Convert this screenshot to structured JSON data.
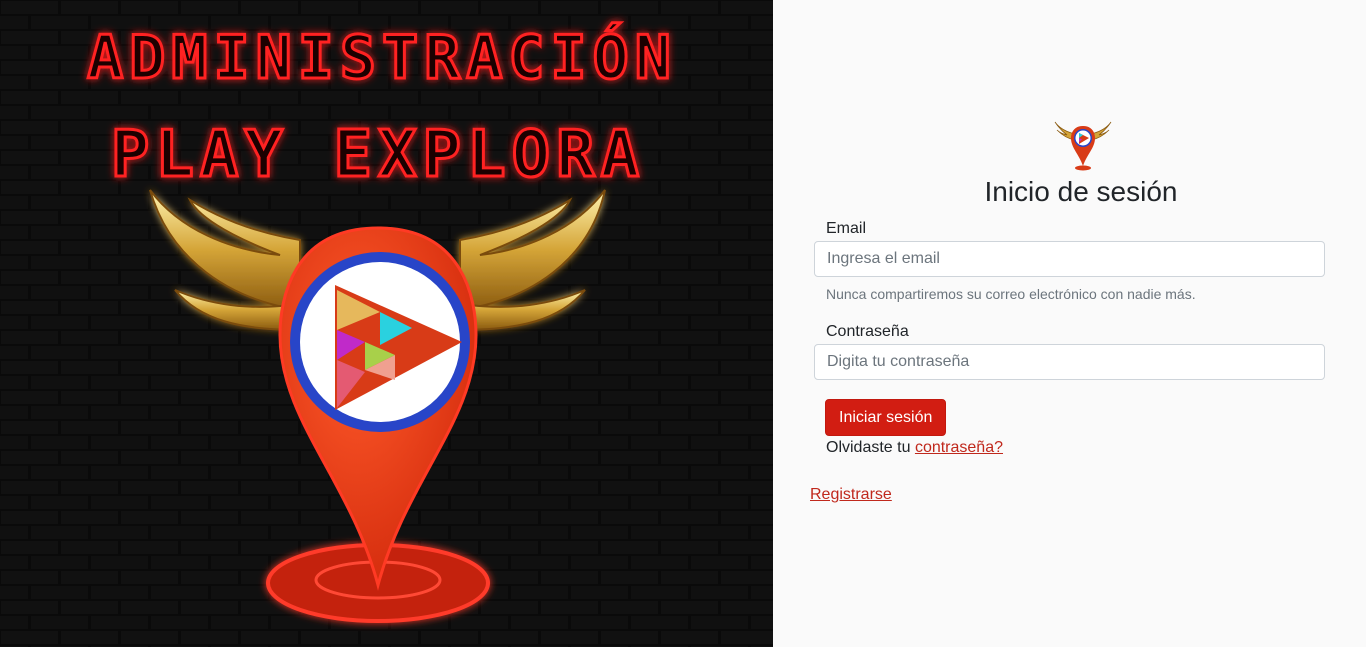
{
  "hero": {
    "line1": "ADMINISTRACIÓN",
    "line2": "PLAY EXPLORA"
  },
  "login": {
    "title": "Inicio de sesión",
    "email_label": "Email",
    "email_placeholder": "Ingresa el email",
    "email_help": "Nunca compartiremos su correo electrónico con nadie más.",
    "password_label": "Contraseña",
    "password_placeholder": "Digita tu contraseña",
    "submit_label": "Iniciar sesión",
    "forgot_prefix": "Olvidaste tu",
    "forgot_link": "contraseña?",
    "register_link": "Registrarse"
  },
  "colors": {
    "accent": "#d21d12",
    "link": "#c0281c",
    "neon": "#ff1a1a",
    "ring": "#2845c8"
  }
}
